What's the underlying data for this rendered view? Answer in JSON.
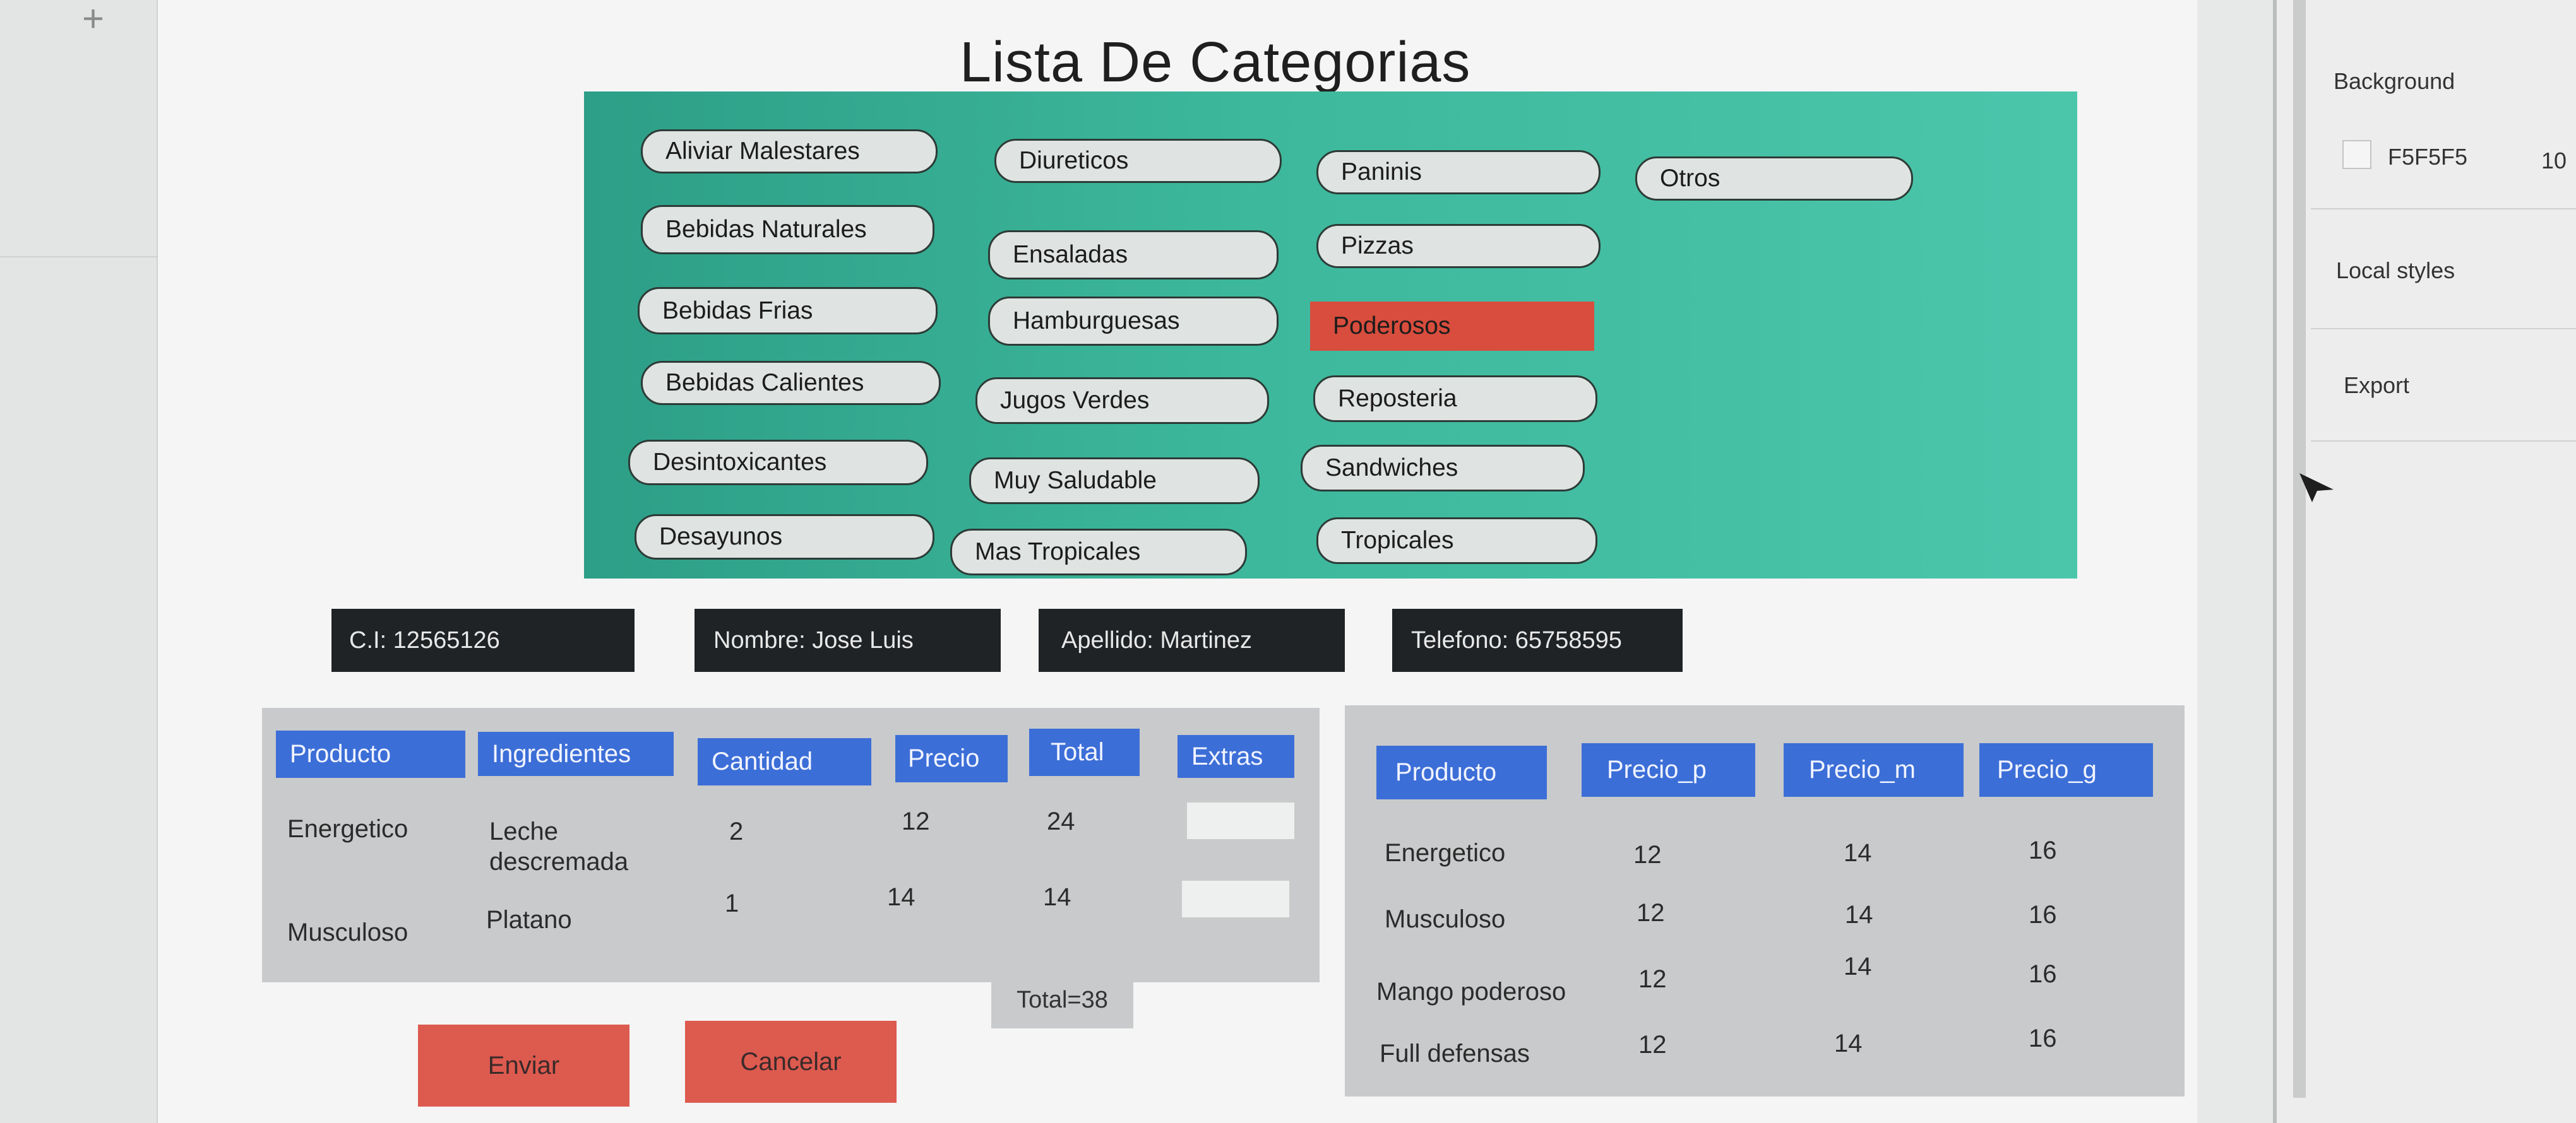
{
  "editor": {
    "right_panel": {
      "background_label": "Background",
      "background_hex": "F5F5F5",
      "opacity_value": "10",
      "local_styles_label": "Local styles",
      "export_label": "Export"
    },
    "plus_glyph": "+"
  },
  "page": {
    "title": "Lista De Categorias"
  },
  "categories": {
    "accent_color": "#3db89c",
    "active_color": "#d84d3d",
    "items": [
      {
        "label": "Aliviar Malestares"
      },
      {
        "label": "Diureticos"
      },
      {
        "label": "Paninis"
      },
      {
        "label": "Otros"
      },
      {
        "label": "Bebidas Naturales"
      },
      {
        "label": "Ensaladas"
      },
      {
        "label": "Pizzas"
      },
      {
        "label": "Bebidas Frias"
      },
      {
        "label": "Hamburguesas"
      },
      {
        "label": "Poderosos",
        "active": true
      },
      {
        "label": "Bebidas Calientes"
      },
      {
        "label": "Jugos Verdes"
      },
      {
        "label": "Reposteria"
      },
      {
        "label": "Desintoxicantes"
      },
      {
        "label": "Muy Saludable"
      },
      {
        "label": "Sandwiches"
      },
      {
        "label": "Desayunos"
      },
      {
        "label": "Mas Tropicales"
      },
      {
        "label": "Tropicales"
      }
    ]
  },
  "customer": {
    "ci": "C.I: 12565126",
    "nombre": "Nombre: Jose Luis",
    "apellido": "Apellido: Martinez",
    "telefono": "Telefono: 65758595"
  },
  "order_table": {
    "headers": [
      "Producto",
      "Ingredientes",
      "Cantidad",
      "Precio",
      "Total",
      "Extras"
    ],
    "rows": [
      {
        "producto": "Energetico",
        "ingredientes_1": "Leche",
        "ingredientes_2": "descremada",
        "cantidad": "2",
        "precio": "12",
        "total": "24"
      },
      {
        "producto": "Musculoso",
        "ingredientes_1": "Platano",
        "ingredientes_2": "",
        "cantidad": "1",
        "precio": "14",
        "total": "14"
      }
    ],
    "grand_total": "Total=38"
  },
  "price_table": {
    "headers": [
      "Producto",
      "Precio_p",
      "Precio_m",
      "Precio_g"
    ],
    "rows": [
      {
        "producto": "Energetico",
        "p": "12",
        "m": "14",
        "g": "16"
      },
      {
        "producto": "Musculoso",
        "p": "12",
        "m": "14",
        "g": "16"
      },
      {
        "producto": "Mango poderoso",
        "p": "12",
        "m": "14",
        "g": "16"
      },
      {
        "producto": "Full defensas",
        "p": "12",
        "m": "14",
        "g": "16"
      }
    ]
  },
  "actions": {
    "enviar": "Enviar",
    "cancelar": "Cancelar"
  }
}
